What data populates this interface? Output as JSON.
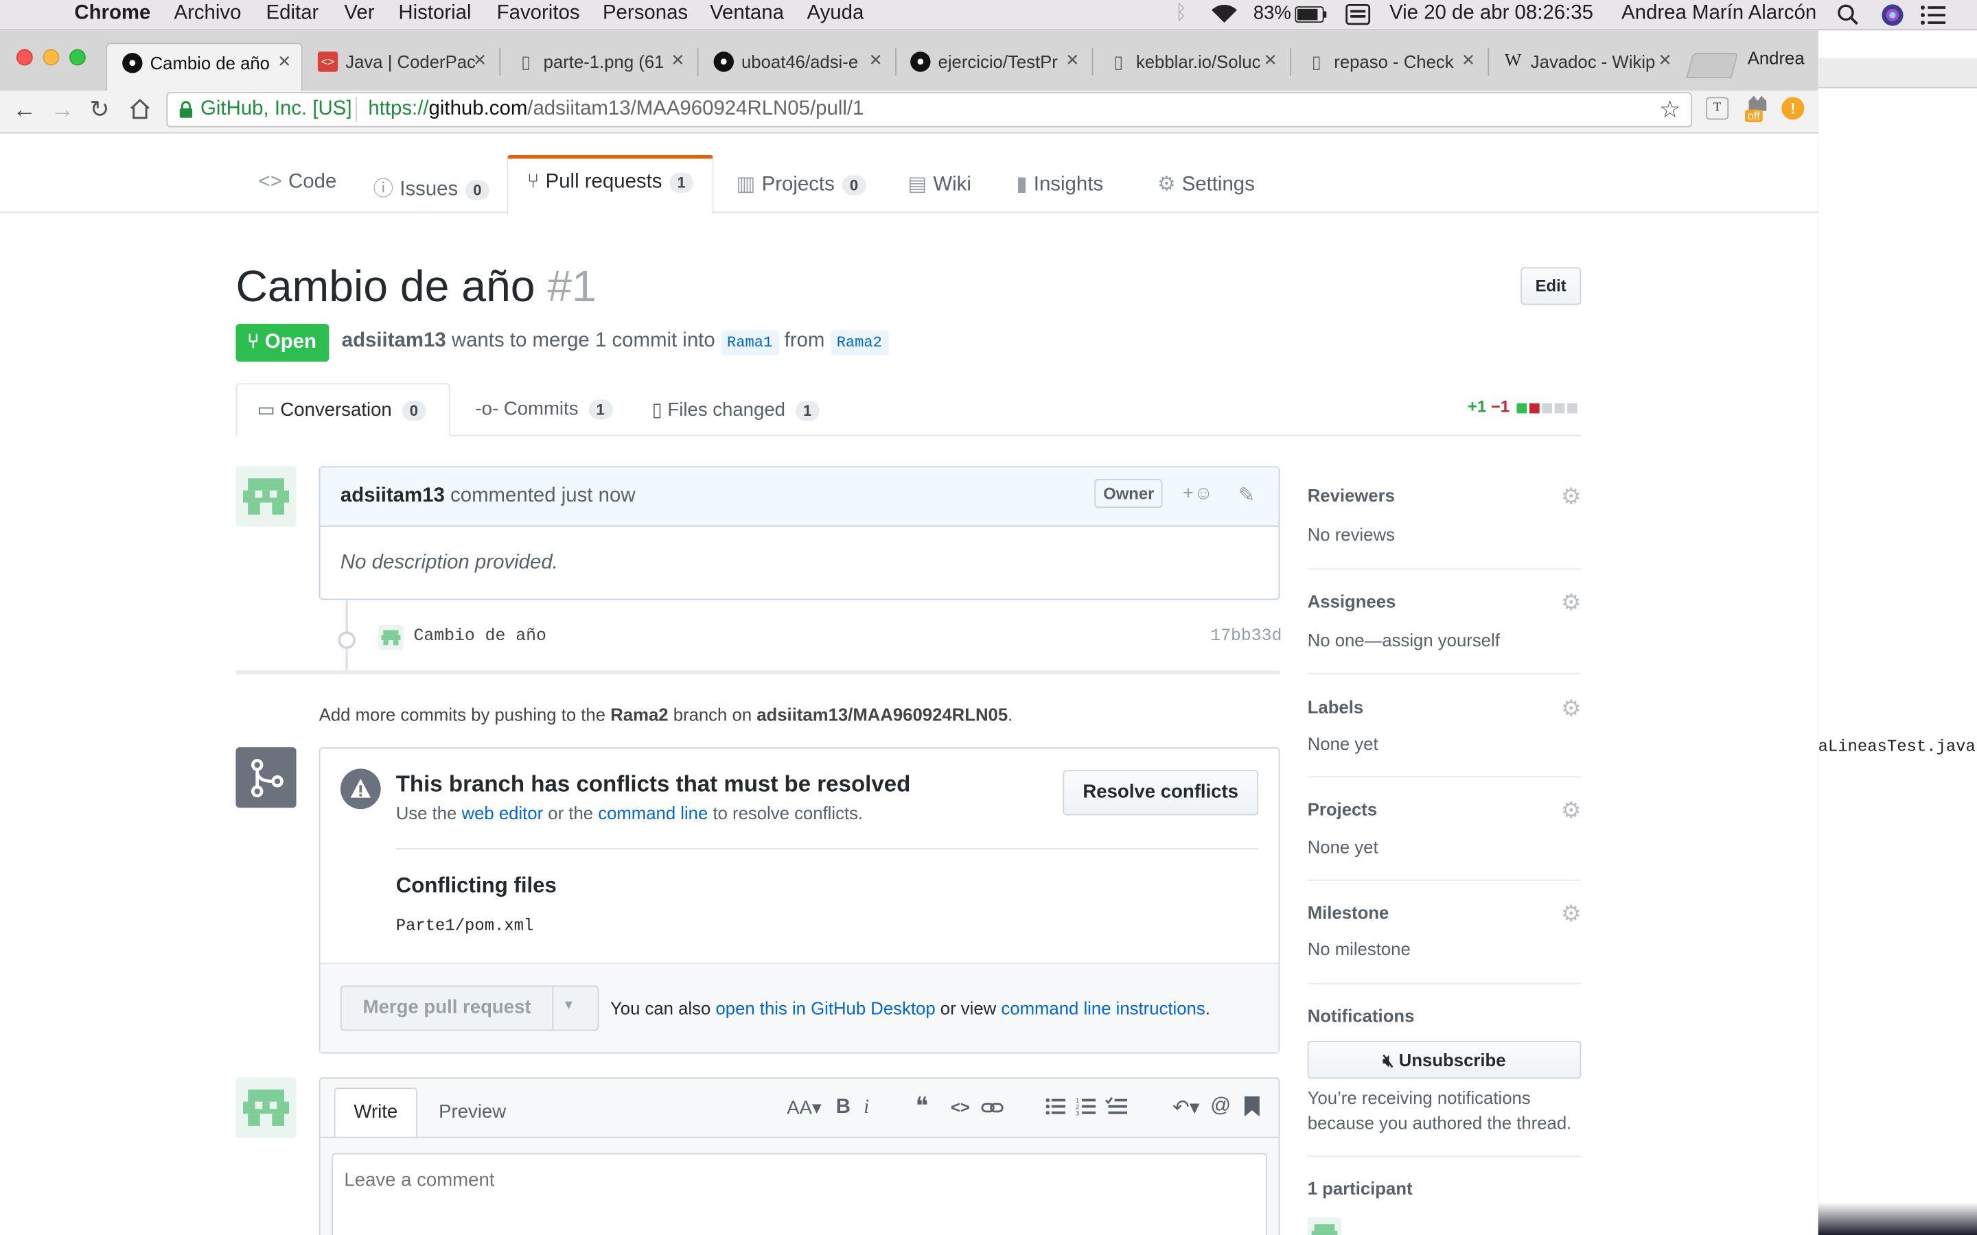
{
  "menubar": {
    "apple_glyph": "",
    "app": "Chrome",
    "menus": [
      "Archivo",
      "Editar",
      "Ver",
      "Historial",
      "Favoritos",
      "Personas",
      "Ventana",
      "Ayuda"
    ],
    "battery": "83%",
    "datetime": "Vie 20 de abr  08:26:35",
    "user": "Andrea Marín Alarcón"
  },
  "browser": {
    "tabs": [
      {
        "title": "Cambio de año",
        "icon": "github-icon"
      },
      {
        "title": "Java | CoderPac",
        "icon": "coderpad-icon"
      },
      {
        "title": "parte-1.png (61",
        "icon": "file-icon"
      },
      {
        "title": "uboat46/adsi-e",
        "icon": "github-icon"
      },
      {
        "title": "ejercicio/TestPr",
        "icon": "github-icon"
      },
      {
        "title": "kebblar.io/Soluc",
        "icon": "file-icon"
      },
      {
        "title": "repaso - Check",
        "icon": "file-icon"
      },
      {
        "title": "Javadoc - Wikip",
        "icon": "wikipedia-icon"
      }
    ],
    "profile": "Andrea",
    "security_label": "GitHub, Inc. [US]",
    "url_scheme": "https://",
    "url_host": "github.com",
    "url_path": "/adsiitam13/MAA960924RLN05/pull/1",
    "ext_badge": "off",
    "ext_alert": "!"
  },
  "repo_nav": {
    "code": "Code",
    "issues": "Issues",
    "issues_count": "0",
    "pull_requests": "Pull requests",
    "pull_requests_count": "1",
    "projects": "Projects",
    "projects_count": "0",
    "wiki": "Wiki",
    "insights": "Insights",
    "settings": "Settings"
  },
  "pr": {
    "title": "Cambio de año",
    "number": "#1",
    "edit_label": "Edit",
    "state": "Open",
    "author": "adsiitam13",
    "merge_text": "wants to merge 1 commit into",
    "base_branch": "Rama1",
    "from_text": "from",
    "head_branch": "Rama2"
  },
  "pr_tabs": {
    "conversation": "Conversation",
    "conversation_count": "0",
    "commits": "Commits",
    "commits_count": "1",
    "files_changed": "Files changed",
    "files_changed_count": "1",
    "additions": "+1",
    "deletions": "−1"
  },
  "comment": {
    "author": "adsiitam13",
    "action": "commented just now",
    "role": "Owner",
    "reaction_plus": "+",
    "body": "No description provided."
  },
  "commit": {
    "message": "Cambio de año",
    "sha": "17bb33d"
  },
  "push_hint": {
    "prefix": "Add more commits by pushing to the",
    "branch": "Rama2",
    "middle": "branch on",
    "repo": "adsiitam13/MAA960924RLN05",
    "suffix": "."
  },
  "merge_box": {
    "conflict_title": "This branch has conflicts that must be resolved",
    "use_the": "Use the",
    "web_editor": "web editor",
    "or_the": "or the",
    "command_line": "command line",
    "to_resolve": "to resolve conflicts.",
    "resolve_button": "Resolve conflicts",
    "conflicting_files_title": "Conflicting files",
    "conflicting_file": "Parte1/pom.xml",
    "merge_button": "Merge pull request",
    "also_text": "You can also",
    "github_desktop_link": "open this in GitHub Desktop",
    "or_view": "or view",
    "cli_link": "command line instructions",
    "period": "."
  },
  "new_comment": {
    "write_tab": "Write",
    "preview_tab": "Preview",
    "heading_tool": "AA",
    "bold_tool": "B",
    "italic_tool": "i",
    "quote_tool": "❝",
    "code_tool": "<>",
    "mention_tool": "@",
    "placeholder": "Leave a comment"
  },
  "sidebar": {
    "reviewers_title": "Reviewers",
    "reviewers_value": "No reviews",
    "assignees_title": "Assignees",
    "assignees_value": "No one—assign yourself",
    "labels_title": "Labels",
    "labels_value": "None yet",
    "projects_title": "Projects",
    "projects_value": "None yet",
    "milestone_title": "Milestone",
    "milestone_value": "No milestone",
    "notifications_title": "Notifications",
    "unsubscribe_label": "Unsubscribe",
    "notifications_reason_1": "You’re receiving notifications",
    "notifications_reason_2": "because you authored the thread.",
    "participants_title": "1 participant"
  },
  "background_window": {
    "filename_fragment": "aLineasTest.java"
  },
  "colors": {
    "open_green": "#2cbe4e",
    "link_blue": "#0366d6",
    "tab_orange": "#e36209",
    "diff_add": "#28a745",
    "diff_del": "#cb2431"
  }
}
